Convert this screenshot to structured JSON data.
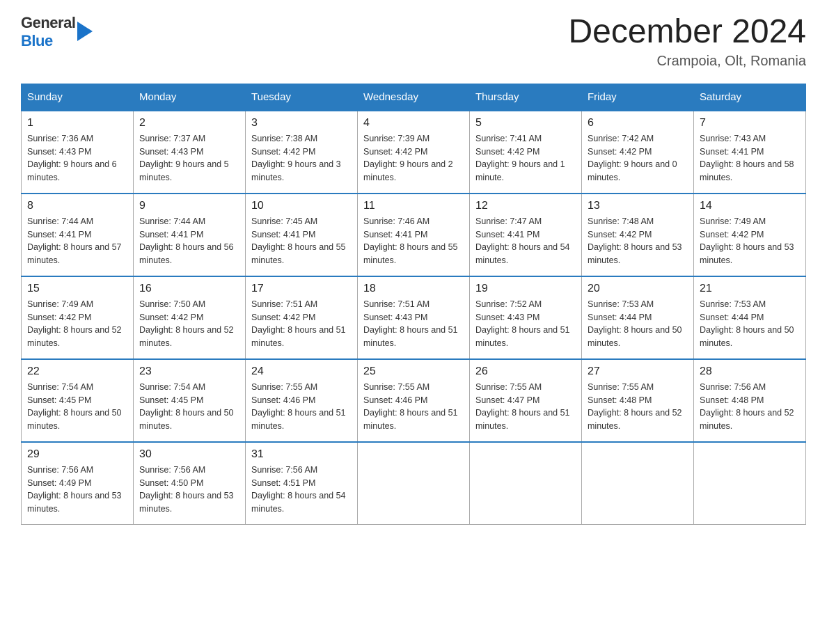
{
  "header": {
    "logo_general": "General",
    "logo_blue": "Blue",
    "month_year": "December 2024",
    "location": "Crampoia, Olt, Romania"
  },
  "days_of_week": [
    "Sunday",
    "Monday",
    "Tuesday",
    "Wednesday",
    "Thursday",
    "Friday",
    "Saturday"
  ],
  "weeks": [
    [
      {
        "day": "1",
        "sunrise": "7:36 AM",
        "sunset": "4:43 PM",
        "daylight": "9 hours and 6 minutes."
      },
      {
        "day": "2",
        "sunrise": "7:37 AM",
        "sunset": "4:43 PM",
        "daylight": "9 hours and 5 minutes."
      },
      {
        "day": "3",
        "sunrise": "7:38 AM",
        "sunset": "4:42 PM",
        "daylight": "9 hours and 3 minutes."
      },
      {
        "day": "4",
        "sunrise": "7:39 AM",
        "sunset": "4:42 PM",
        "daylight": "9 hours and 2 minutes."
      },
      {
        "day": "5",
        "sunrise": "7:41 AM",
        "sunset": "4:42 PM",
        "daylight": "9 hours and 1 minute."
      },
      {
        "day": "6",
        "sunrise": "7:42 AM",
        "sunset": "4:42 PM",
        "daylight": "9 hours and 0 minutes."
      },
      {
        "day": "7",
        "sunrise": "7:43 AM",
        "sunset": "4:41 PM",
        "daylight": "8 hours and 58 minutes."
      }
    ],
    [
      {
        "day": "8",
        "sunrise": "7:44 AM",
        "sunset": "4:41 PM",
        "daylight": "8 hours and 57 minutes."
      },
      {
        "day": "9",
        "sunrise": "7:44 AM",
        "sunset": "4:41 PM",
        "daylight": "8 hours and 56 minutes."
      },
      {
        "day": "10",
        "sunrise": "7:45 AM",
        "sunset": "4:41 PM",
        "daylight": "8 hours and 55 minutes."
      },
      {
        "day": "11",
        "sunrise": "7:46 AM",
        "sunset": "4:41 PM",
        "daylight": "8 hours and 55 minutes."
      },
      {
        "day": "12",
        "sunrise": "7:47 AM",
        "sunset": "4:41 PM",
        "daylight": "8 hours and 54 minutes."
      },
      {
        "day": "13",
        "sunrise": "7:48 AM",
        "sunset": "4:42 PM",
        "daylight": "8 hours and 53 minutes."
      },
      {
        "day": "14",
        "sunrise": "7:49 AM",
        "sunset": "4:42 PM",
        "daylight": "8 hours and 53 minutes."
      }
    ],
    [
      {
        "day": "15",
        "sunrise": "7:49 AM",
        "sunset": "4:42 PM",
        "daylight": "8 hours and 52 minutes."
      },
      {
        "day": "16",
        "sunrise": "7:50 AM",
        "sunset": "4:42 PM",
        "daylight": "8 hours and 52 minutes."
      },
      {
        "day": "17",
        "sunrise": "7:51 AM",
        "sunset": "4:42 PM",
        "daylight": "8 hours and 51 minutes."
      },
      {
        "day": "18",
        "sunrise": "7:51 AM",
        "sunset": "4:43 PM",
        "daylight": "8 hours and 51 minutes."
      },
      {
        "day": "19",
        "sunrise": "7:52 AM",
        "sunset": "4:43 PM",
        "daylight": "8 hours and 51 minutes."
      },
      {
        "day": "20",
        "sunrise": "7:53 AM",
        "sunset": "4:44 PM",
        "daylight": "8 hours and 50 minutes."
      },
      {
        "day": "21",
        "sunrise": "7:53 AM",
        "sunset": "4:44 PM",
        "daylight": "8 hours and 50 minutes."
      }
    ],
    [
      {
        "day": "22",
        "sunrise": "7:54 AM",
        "sunset": "4:45 PM",
        "daylight": "8 hours and 50 minutes."
      },
      {
        "day": "23",
        "sunrise": "7:54 AM",
        "sunset": "4:45 PM",
        "daylight": "8 hours and 50 minutes."
      },
      {
        "day": "24",
        "sunrise": "7:55 AM",
        "sunset": "4:46 PM",
        "daylight": "8 hours and 51 minutes."
      },
      {
        "day": "25",
        "sunrise": "7:55 AM",
        "sunset": "4:46 PM",
        "daylight": "8 hours and 51 minutes."
      },
      {
        "day": "26",
        "sunrise": "7:55 AM",
        "sunset": "4:47 PM",
        "daylight": "8 hours and 51 minutes."
      },
      {
        "day": "27",
        "sunrise": "7:55 AM",
        "sunset": "4:48 PM",
        "daylight": "8 hours and 52 minutes."
      },
      {
        "day": "28",
        "sunrise": "7:56 AM",
        "sunset": "4:48 PM",
        "daylight": "8 hours and 52 minutes."
      }
    ],
    [
      {
        "day": "29",
        "sunrise": "7:56 AM",
        "sunset": "4:49 PM",
        "daylight": "8 hours and 53 minutes."
      },
      {
        "day": "30",
        "sunrise": "7:56 AM",
        "sunset": "4:50 PM",
        "daylight": "8 hours and 53 minutes."
      },
      {
        "day": "31",
        "sunrise": "7:56 AM",
        "sunset": "4:51 PM",
        "daylight": "8 hours and 54 minutes."
      },
      null,
      null,
      null,
      null
    ]
  ],
  "labels": {
    "sunrise": "Sunrise:",
    "sunset": "Sunset:",
    "daylight": "Daylight:"
  }
}
